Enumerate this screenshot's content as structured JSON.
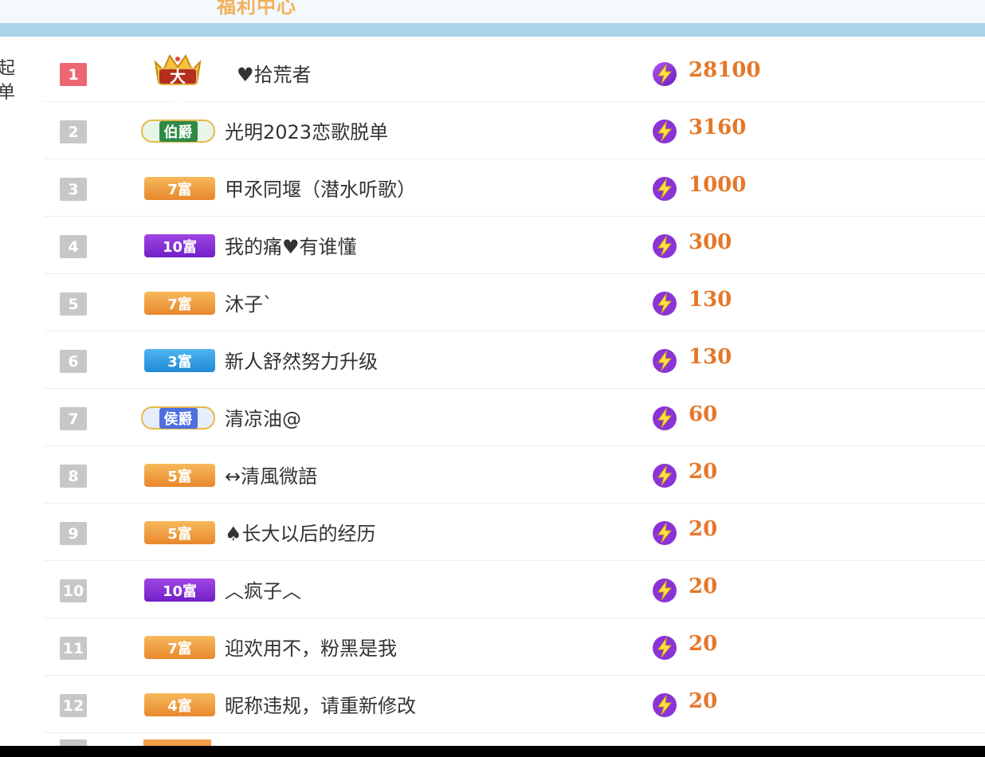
{
  "header": {
    "title": "福利中心"
  },
  "left_sliver": [
    "起",
    "单"
  ],
  "rows": [
    {
      "rank": "1",
      "badge": "大帝",
      "name": "♥拾荒者",
      "score": "28100"
    },
    {
      "rank": "2",
      "badge": "伯爵",
      "name": "光明2023恋歌脱单",
      "score": "3160"
    },
    {
      "rank": "3",
      "badge": "7富",
      "name": "甲氶同堰（潜水听歌）",
      "score": "1000"
    },
    {
      "rank": "4",
      "badge": "10富",
      "name": "我的痛♥有谁懂",
      "score": "300"
    },
    {
      "rank": "5",
      "badge": "7富",
      "name": "沐子`",
      "score": "130"
    },
    {
      "rank": "6",
      "badge": "3富",
      "name": "新人舒然努力升级",
      "score": "130"
    },
    {
      "rank": "7",
      "badge": "侯爵",
      "name": "清凉油@",
      "score": "60"
    },
    {
      "rank": "8",
      "badge": "5富",
      "name": "↔清風微語",
      "score": "20"
    },
    {
      "rank": "9",
      "badge": "5富",
      "name": "♠长大以后的经历",
      "score": "20"
    },
    {
      "rank": "10",
      "badge": "10富",
      "name": "︿疯子︿",
      "score": "20"
    },
    {
      "rank": "11",
      "badge": "7富",
      "name": "迎欢用不，粉黑是我",
      "score": "20"
    },
    {
      "rank": "12",
      "badge": "4富",
      "name": "昵称违规，请重新修改",
      "score": "20"
    }
  ],
  "colors": {
    "score": "#e5772a",
    "rank_first": "#ec6773",
    "rank_default": "#c7c7c7",
    "header_bar": "#a9d3e8"
  },
  "icons": {
    "score_icon": "lightning-bolt-icon",
    "emperor_icon": "crown-icon"
  }
}
